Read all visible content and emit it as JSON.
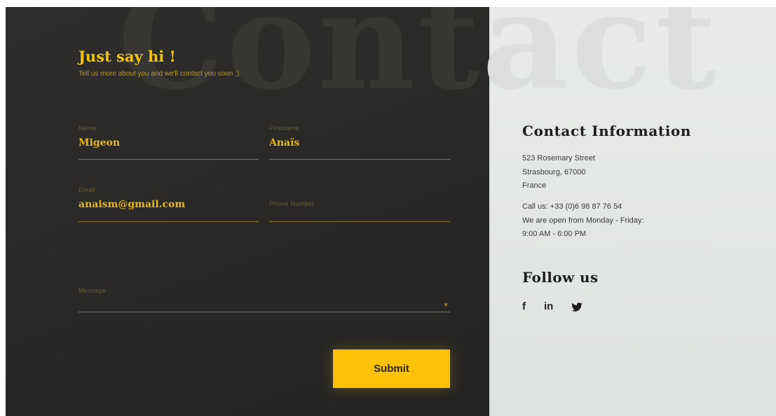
{
  "form": {
    "heading": "Just say hi !",
    "subheading": "Tell us more about you and we'll contact you soon :)",
    "background_word": "Contact",
    "fields": {
      "name": {
        "label": "Name",
        "value": "Migeon"
      },
      "firstname": {
        "label": "Firstname",
        "value": "Anaïs"
      },
      "email": {
        "label": "Email",
        "value": "anaism@gmail.com"
      },
      "phone": {
        "label": "Phone Number",
        "value": ""
      },
      "message": {
        "label": "Message",
        "value": ""
      }
    },
    "submit_label": "Submit"
  },
  "contact": {
    "title": "Contact Information",
    "address": [
      "523 Rosemary Street",
      "Strasbourg, 67000",
      "France"
    ],
    "call": "Call us: +33 (0)6 98 87 76 54",
    "hours_line1": "We are open from Monday - Friday:",
    "hours_line2": "9:00 AM - 6:00 PM"
  },
  "follow": {
    "title": "Follow us",
    "icons": [
      "facebook-icon",
      "linkedin-icon",
      "twitter-icon"
    ]
  },
  "colors": {
    "accent": "#fcc207",
    "dark_panel": "#2a2927",
    "light_panel": "#e4e7e4"
  }
}
